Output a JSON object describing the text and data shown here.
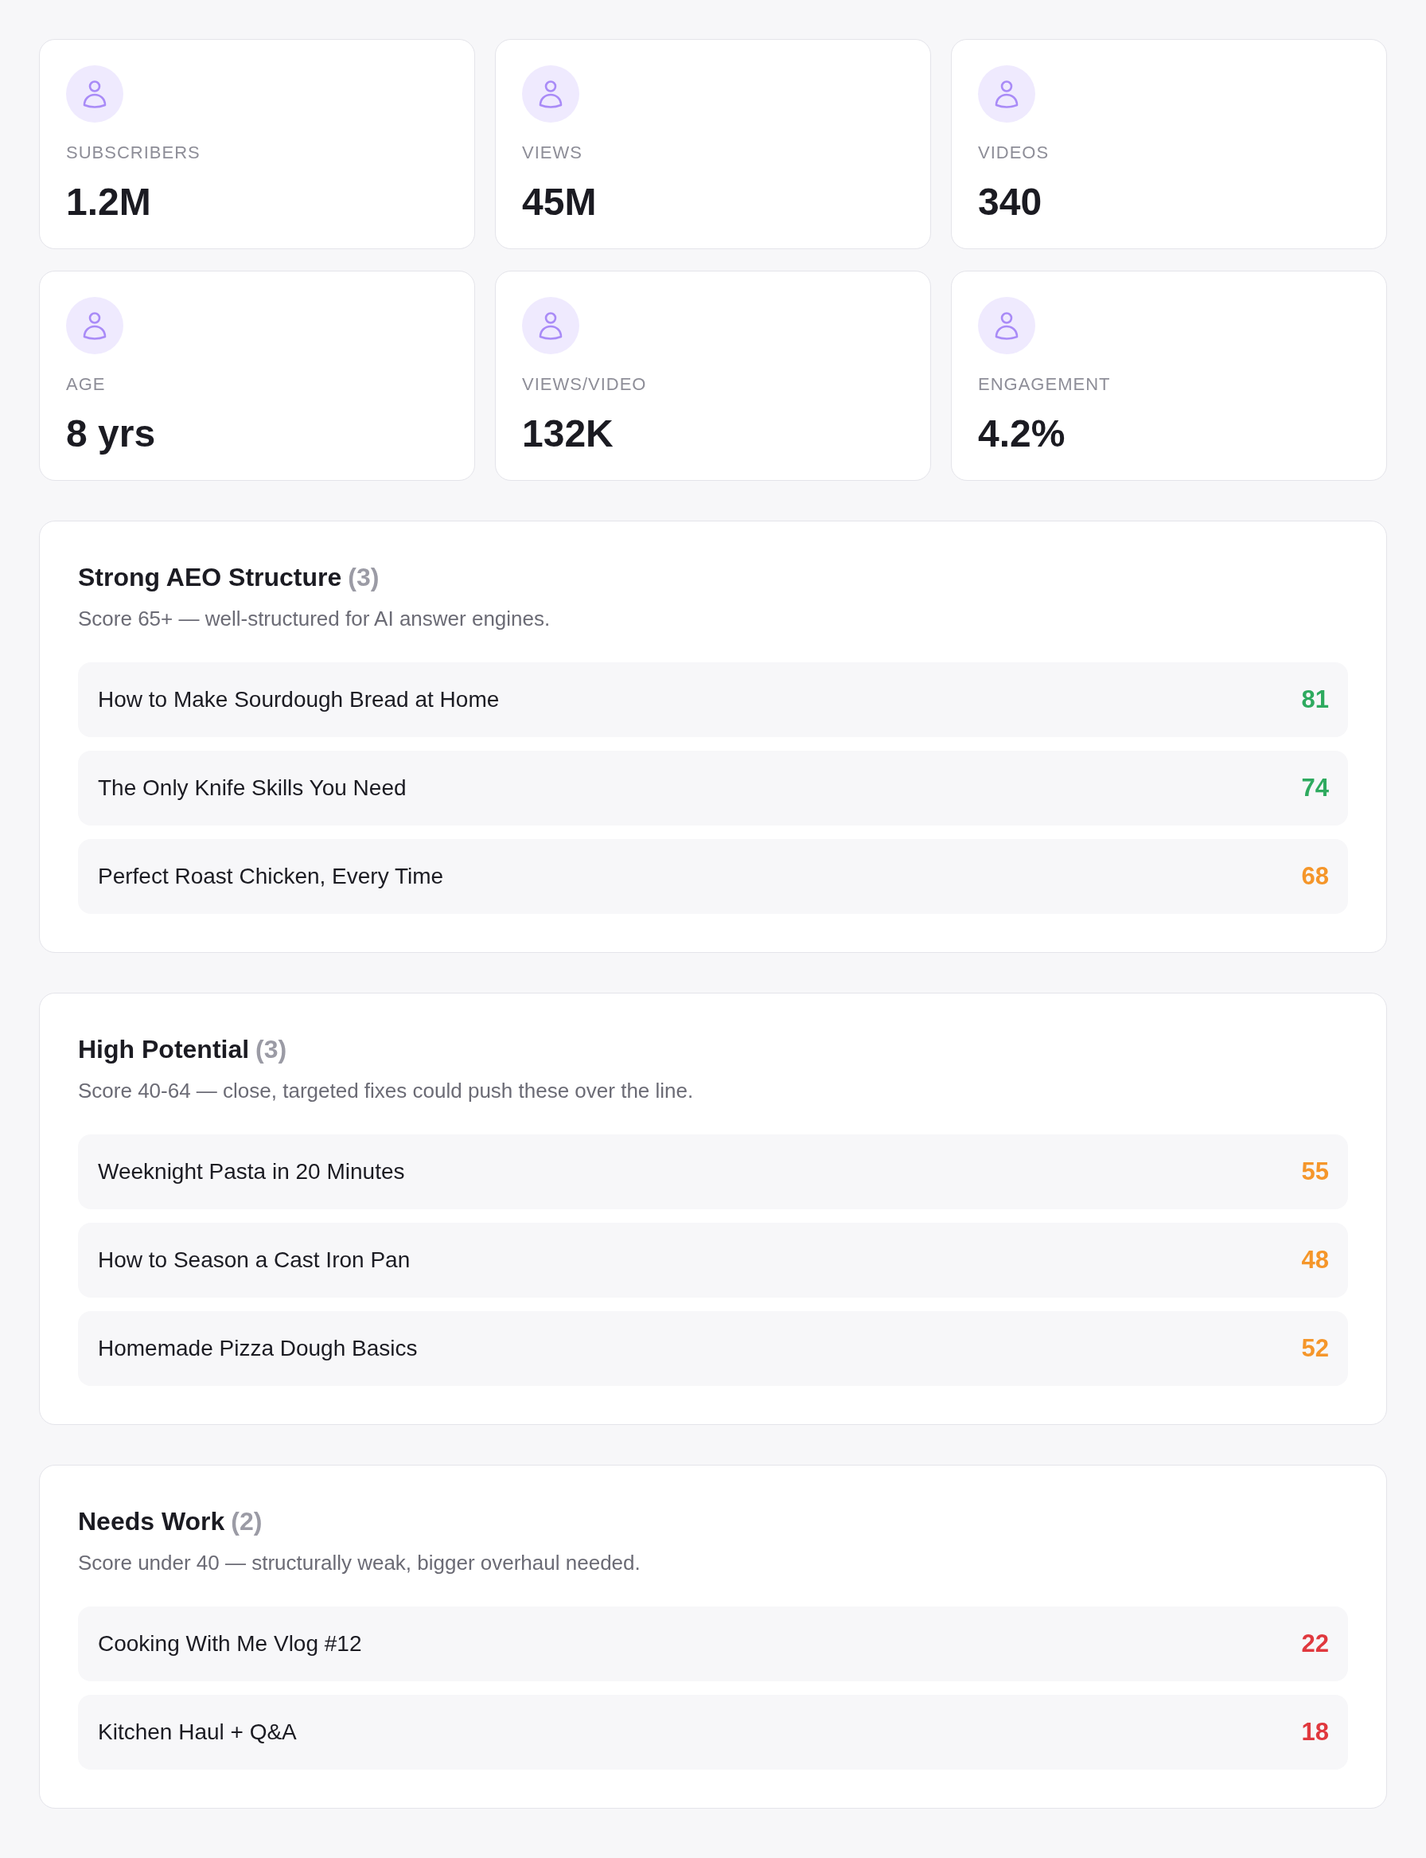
{
  "stats": [
    {
      "label": "SUBSCRIBERS",
      "value": "1.2M"
    },
    {
      "label": "VIEWS",
      "value": "45M"
    },
    {
      "label": "VIDEOS",
      "value": "340"
    },
    {
      "label": "AGE",
      "value": "8 yrs"
    },
    {
      "label": "VIEWS/VIDEO",
      "value": "132K"
    },
    {
      "label": "ENGAGEMENT",
      "value": "4.2%"
    }
  ],
  "sections": [
    {
      "title": "Strong AEO Structure",
      "count": "(3)",
      "description": "Score 65+ — well-structured for AI answer engines.",
      "videos": [
        {
          "title": "How to Make Sourdough Bread at Home",
          "score": "81",
          "color": "#2eaa5f"
        },
        {
          "title": "The Only Knife Skills You Need",
          "score": "74",
          "color": "#2eaa5f"
        },
        {
          "title": "Perfect Roast Chicken, Every Time",
          "score": "68",
          "color": "#f5962a"
        }
      ]
    },
    {
      "title": "High Potential",
      "count": "(3)",
      "description": "Score 40-64 — close, targeted fixes could push these over the line.",
      "videos": [
        {
          "title": "Weeknight Pasta in 20 Minutes",
          "score": "55",
          "color": "#f5962a"
        },
        {
          "title": "How to Season a Cast Iron Pan",
          "score": "48",
          "color": "#f5962a"
        },
        {
          "title": "Homemade Pizza Dough Basics",
          "score": "52",
          "color": "#f5962a"
        }
      ]
    },
    {
      "title": "Needs Work",
      "count": "(2)",
      "description": "Score under 40 — structurally weak, bigger overhaul needed.",
      "videos": [
        {
          "title": "Cooking With Me Vlog #12",
          "score": "22",
          "color": "#e0383e"
        },
        {
          "title": "Kitchen Haul + Q&A",
          "score": "18",
          "color": "#e0383e"
        }
      ]
    }
  ]
}
